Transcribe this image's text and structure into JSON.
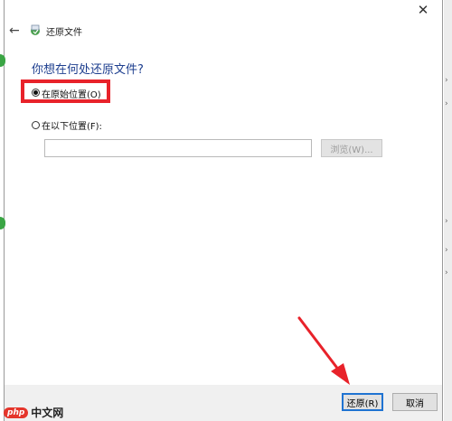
{
  "window": {
    "close_glyph": "✕",
    "title": "还原文件"
  },
  "nav": {
    "back_glyph": "←"
  },
  "main": {
    "heading": "你想在何处还原文件?",
    "option_original": "在原始位置(O)",
    "option_other": "在以下位置(F):",
    "selected_option": "original",
    "path_value": "",
    "browse_label": "浏览(W)..."
  },
  "footer": {
    "restore_label": "还原(R)",
    "cancel_label": "取消"
  },
  "watermark": {
    "logo": "php",
    "text": "中文网"
  },
  "colors": {
    "highlight": "#e8222a",
    "arrow": "#e8222a",
    "heading": "#1e3f8f",
    "focus": "#1f73d2"
  }
}
